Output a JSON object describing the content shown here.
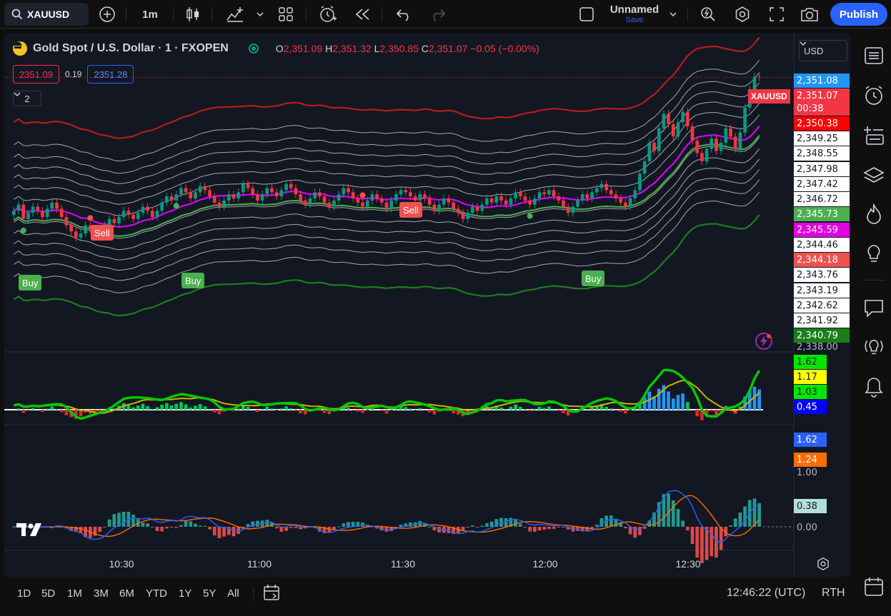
{
  "toolbar": {
    "symbol": "XAUUSD",
    "interval": "1m",
    "layout_name": "Unnamed",
    "save_label": "Save",
    "publish_label": "Publish"
  },
  "legend": {
    "title": "Gold Spot / U.S. Dollar · 1 · FXOPEN",
    "open_label": "O",
    "open": "2,351.09",
    "high_label": "H",
    "high": "2,351.32",
    "low_label": "L",
    "low": "2,350.85",
    "close_label": "C",
    "close": "2,351.07",
    "change": "−0.05 (−0.00%)"
  },
  "quote": {
    "sell": "2351.09",
    "spread": "0.19",
    "buy": "2351.28"
  },
  "collapse_count": "2",
  "currency": "USD",
  "symbol_tag": "XAUUSD",
  "price_labels": {
    "top_partial": "2,351.08",
    "last": "2,351.07",
    "countdown": "00:38",
    "l1": "2,350.38",
    "l2": "2,349.25",
    "l3": "2,348.55",
    "l4": "2,347.98",
    "l5": "2,347.42",
    "l6": "2,346.72",
    "l7": "2,345.73",
    "l8": "2,345.59",
    "l9": "2,344.46",
    "l10": "2,344.18",
    "l11": "2,343.76",
    "l12": "2,343.19",
    "l13": "2,342.62",
    "l14": "2,341.92",
    "l15": "2,340.79",
    "axis_bottom": "2,338.00"
  },
  "signals": {
    "buy": "Buy",
    "sell": "Sell"
  },
  "osc1_labels": {
    "a": "1.62",
    "b": "1.17",
    "c": "1.03",
    "d": "0.45"
  },
  "osc2_labels": {
    "a": "1.62",
    "b": "1.24",
    "t1": "1.00",
    "t2": "0.38",
    "t3": "0.00"
  },
  "time_axis": [
    "10:30",
    "11:00",
    "11:30",
    "12:00",
    "12:30"
  ],
  "ranges": [
    "1D",
    "5D",
    "1M",
    "3M",
    "6M",
    "YTD",
    "1Y",
    "5Y",
    "All"
  ],
  "clock": "12:46:22 (UTC)",
  "session": "RTH",
  "colors": {
    "up": "#089981",
    "down": "#f23645",
    "magenta": "#d500f9",
    "green_band": "#4caf50",
    "red_band": "#b71c1c",
    "accent": "#2962ff"
  },
  "chart_data": {
    "type": "candlestick",
    "symbol": "XAUUSD",
    "interval": "1m",
    "ylim": [
      2338.0,
      2351.5
    ],
    "x": [
      "10:30",
      "11:00",
      "11:30",
      "12:00",
      "12:30"
    ],
    "close_series": [
      2344.6,
      2344.9,
      2344.2,
      2344.5,
      2344.8,
      2344.6,
      2344.3,
      2344.7,
      2345.0,
      2344.7,
      2344.3,
      2343.9,
      2343.6,
      2343.3,
      2343.5,
      2343.9,
      2343.7,
      2343.4,
      2343.6,
      2343.9,
      2344.2,
      2344.0,
      2344.3,
      2344.6,
      2344.4,
      2344.2,
      2344.5,
      2344.8,
      2344.6,
      2344.3,
      2344.6,
      2345.0,
      2345.3,
      2345.1,
      2345.4,
      2345.7,
      2345.5,
      2345.2,
      2345.5,
      2345.8,
      2345.6,
      2345.3,
      2345.0,
      2344.8,
      2345.1,
      2345.4,
      2345.2,
      2345.5,
      2345.9,
      2345.7,
      2345.4,
      2345.1,
      2345.4,
      2345.7,
      2345.5,
      2345.3,
      2345.6,
      2345.9,
      2345.7,
      2345.4,
      2345.1,
      2344.9,
      2345.2,
      2345.5,
      2345.3,
      2345.0,
      2344.8,
      2345.1,
      2345.4,
      2345.7,
      2345.5,
      2345.2,
      2345.0,
      2344.8,
      2345.1,
      2345.4,
      2345.2,
      2345.0,
      2344.7,
      2345.1,
      2345.4,
      2345.6,
      2345.5,
      2345.3,
      2345.1,
      2345.4,
      2345.2,
      2344.9,
      2344.6,
      2344.9,
      2345.2,
      2345.0,
      2344.7,
      2344.5,
      2344.2,
      2344.5,
      2344.8,
      2344.6,
      2344.9,
      2345.2,
      2345.0,
      2345.3,
      2345.1,
      2344.9,
      2345.2,
      2345.5,
      2345.3,
      2345.1,
      2344.9,
      2345.2,
      2345.5,
      2345.4,
      2345.6,
      2345.3,
      2345.1,
      2344.8,
      2344.5,
      2344.8,
      2345.1,
      2345.4,
      2345.2,
      2345.5,
      2345.7,
      2345.9,
      2345.6,
      2345.4,
      2345.2,
      2345.0,
      2344.8,
      2345.2,
      2345.6,
      2346.4,
      2347.0,
      2347.9,
      2347.5,
      2348.6,
      2349.3,
      2348.8,
      2348.2,
      2348.9,
      2349.4,
      2348.7,
      2348.0,
      2347.4,
      2347.0,
      2347.6,
      2348.1,
      2347.5,
      2347.9,
      2348.6,
      2348.2,
      2347.6,
      2348.4,
      2349.6,
      2350.5,
      2351.1,
      2351.07
    ],
    "annotations": [
      {
        "label": "Buy",
        "time_index": 2
      },
      {
        "label": "Sell",
        "time_index": 16
      },
      {
        "label": "Buy",
        "time_index": 34
      },
      {
        "label": "Sell",
        "time_index": 73
      },
      {
        "label": "Buy",
        "time_index": 108
      }
    ]
  }
}
